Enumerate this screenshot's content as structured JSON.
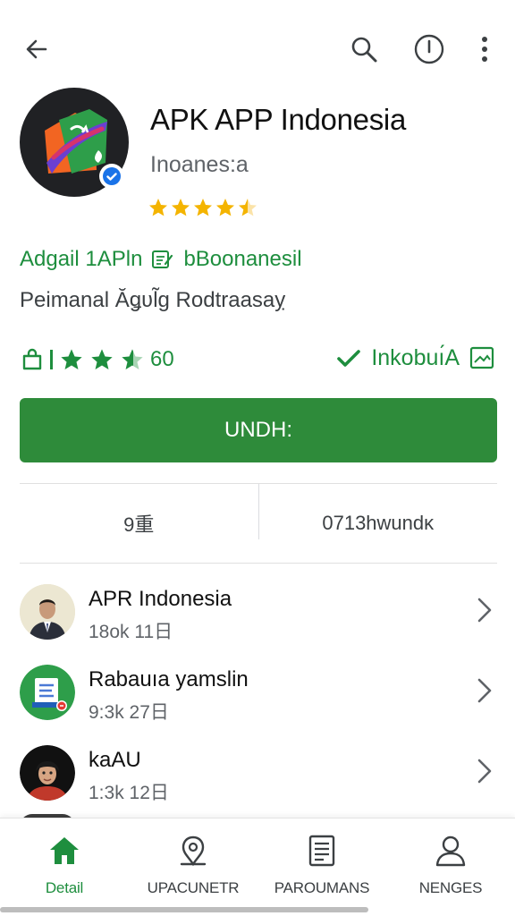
{
  "toolbar": {
    "icons": [
      "back-arrow-icon",
      "search-icon",
      "info-icon",
      "more-vert-icon"
    ]
  },
  "app": {
    "title": "APK APP Indonesia",
    "developer": "Inoanes:a",
    "rating_stars": 4.5,
    "tagline_left": "Adgail 1APln",
    "tagline_right": "bBoonanesil",
    "subtitle": "Peimanal Ӑǥʋl̃g Rodtraasaỵ",
    "rating_text": "60",
    "status_text": "Inkobuı́A",
    "install_label": "UNDH:"
  },
  "stats": [
    {
      "value": "9重"
    },
    {
      "value": "0713hwundĸ"
    }
  ],
  "list": [
    {
      "name": "APR Indonesia",
      "meta": "18ok  11日",
      "avatar": "person-avatar-suit"
    },
    {
      "name": "Rabauıa yamslin",
      "meta": "9:3k  27日",
      "avatar": "document-app-icon"
    },
    {
      "name": "kaAU",
      "meta": "1:3k  12日",
      "avatar": "person-avatar-hijab"
    }
  ],
  "bottom_nav": [
    {
      "label": "Detail",
      "icon": "home-icon",
      "active": true
    },
    {
      "label": "UPACUNETR",
      "icon": "search-person-icon",
      "active": false
    },
    {
      "label": "PAROUMANS",
      "icon": "document-icon",
      "active": false
    },
    {
      "label": "NENGES",
      "icon": "person-icon",
      "active": false
    }
  ],
  "colors": {
    "accent": "#2e8b3a",
    "accent_text": "#1e8e3e",
    "star": "#f4b400",
    "verified": "#1a73e8"
  }
}
